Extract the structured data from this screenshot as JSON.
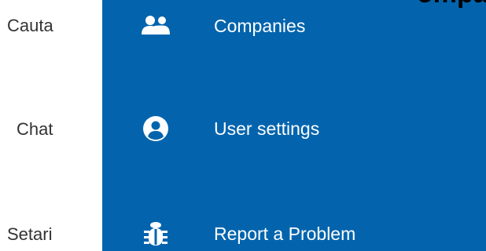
{
  "rail": {
    "items": [
      {
        "label": "Cauta"
      },
      {
        "label": "Chat"
      },
      {
        "label": "Setari"
      }
    ]
  },
  "menu": {
    "background": "#0364ad",
    "items": [
      {
        "label": "Companies",
        "icon": "users-icon"
      },
      {
        "label": "User settings",
        "icon": "user-circle-icon"
      },
      {
        "label": "Report a Problem",
        "icon": "bug-icon"
      }
    ]
  },
  "top_cut_text": "ompanies, "
}
